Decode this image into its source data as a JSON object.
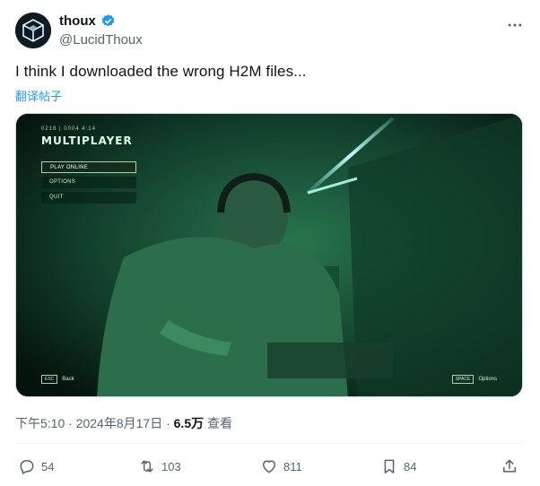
{
  "tweet": {
    "author": {
      "display_name": "thoux",
      "handle": "@LucidThoux",
      "verified": true,
      "avatar_icon": "cube-logo-icon"
    },
    "text": "I think I downloaded the wrong H2M files...",
    "translate_label": "翻译帖子",
    "timestamp": "下午5:10 · 2024年8月17日 · ",
    "views_count": "6.5万",
    "views_label": " 查看",
    "stats": {
      "replies": "54",
      "retweets": "103",
      "likes": "811",
      "bookmarks": "84"
    }
  },
  "media": {
    "game_subtitle": "0218 | 0004 4:14",
    "game_title": "MULTIPLAYER",
    "menu": [
      "PLAY ONLINE",
      "OPTIONS",
      "QUIT"
    ],
    "hint_back_key": "ESC",
    "hint_back": "Back",
    "hint_options_key": "SPACE",
    "hint_options": "Options"
  },
  "colors": {
    "accent": "#1d9bf0",
    "text_primary": "#0f1419",
    "text_secondary": "#536471",
    "media_tint": "#0b2a1e"
  }
}
